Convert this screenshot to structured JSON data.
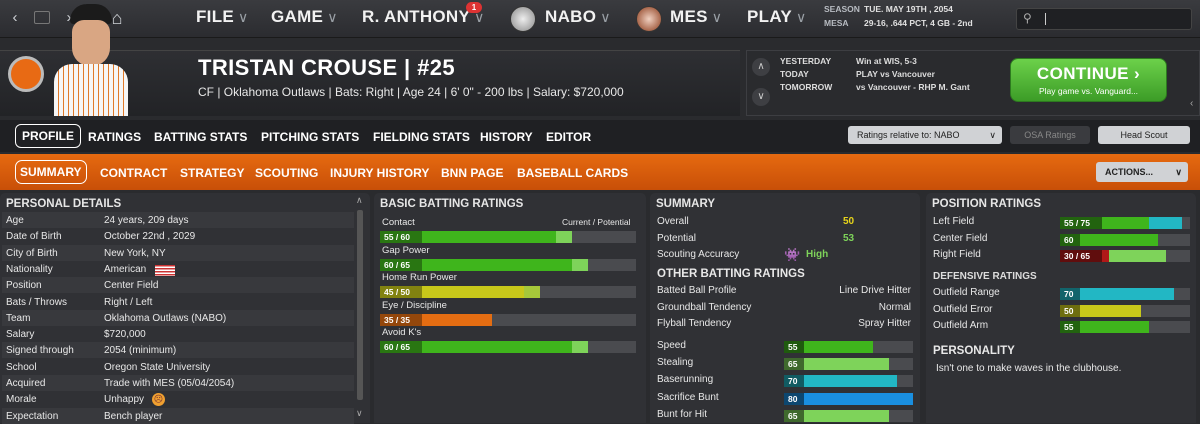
{
  "topbar": {
    "menus": [
      {
        "label": "FILE"
      },
      {
        "label": "GAME"
      },
      {
        "label": "R. ANTHONY",
        "badge": "1"
      },
      {
        "label": "NABO"
      },
      {
        "label": "MES"
      },
      {
        "label": "PLAY"
      }
    ],
    "season_label": "SEASON",
    "season_value": "TUE. MAY 19TH , 2054",
    "team_label": "MESA",
    "team_value": "29-16, .644 PCT, 4 GB - 2nd"
  },
  "player": {
    "name": "TRISTAN CROUSE",
    "separator": "|",
    "number": "#25",
    "info": "CF | Oklahoma Outlaws  |  Bats: Right  |  Age 24  |  6' 0\" - 200 lbs  |  Salary: $720,000"
  },
  "schedule": {
    "rows": [
      {
        "label": "YESTERDAY",
        "value": "Win at WIS, 5-3"
      },
      {
        "label": "TODAY",
        "value": "PLAY vs Vancouver"
      },
      {
        "label": "TOMORROW",
        "value": "vs Vancouver - RHP M. Gant"
      }
    ],
    "continue_label": "CONTINUE",
    "continue_sub": "Play game vs. Vanguard..."
  },
  "tabs1": [
    "PROFILE",
    "RATINGS",
    "BATTING STATS",
    "PITCHING STATS",
    "FIELDING STATS",
    "HISTORY",
    "EDITOR"
  ],
  "ratings_relative": "Ratings relative to: NABO",
  "osa_ratings": "OSA Ratings",
  "head_scout": "Head Scout",
  "tabs2": [
    "SUMMARY",
    "CONTRACT",
    "STRATEGY",
    "SCOUTING",
    "INJURY HISTORY",
    "BNN PAGE",
    "BASEBALL CARDS"
  ],
  "actions": "ACTIONS...",
  "personal": {
    "title": "PERSONAL DETAILS",
    "rows": [
      {
        "k": "Age",
        "v": "24 years, 209 days"
      },
      {
        "k": "Date of Birth",
        "v": "October 22nd , 2029"
      },
      {
        "k": "City of Birth",
        "v": "New York, NY"
      },
      {
        "k": "Nationality",
        "v": "American"
      },
      {
        "k": "Position",
        "v": "Center Field"
      },
      {
        "k": "Bats / Throws",
        "v": "Right / Left"
      },
      {
        "k": "Team",
        "v": "Oklahoma Outlaws (NABO)"
      },
      {
        "k": "Salary",
        "v": "$720,000"
      },
      {
        "k": "Signed through",
        "v": "2054 (minimum)"
      },
      {
        "k": "School",
        "v": "Oregon State University"
      },
      {
        "k": "Acquired",
        "v": "Trade with MES (05/04/2054)"
      },
      {
        "k": "Morale",
        "v": "Unhappy"
      },
      {
        "k": "Expectation",
        "v": "Bench player"
      }
    ]
  },
  "batting": {
    "title": "BASIC BATTING RATINGS",
    "subhead_left": "Contact",
    "subhead_right": "Current / Potential",
    "rows": [
      {
        "label": "Contact",
        "text": "55 / 60",
        "cur": 55,
        "pot": 60,
        "color": "#3fb51c",
        "pcolor": "#7ed35a"
      },
      {
        "label": "Gap Power",
        "text": "60 / 65",
        "cur": 60,
        "pot": 65,
        "color": "#3fb51c",
        "pcolor": "#7ed35a"
      },
      {
        "label": "Home Run Power",
        "text": "45 / 50",
        "cur": 45,
        "pot": 50,
        "color": "#c8c81a",
        "pcolor": "#a6c83a"
      },
      {
        "label": "Eye / Discipline",
        "text": "35 / 35",
        "cur": 35,
        "pot": 35,
        "color": "#e46d12",
        "pcolor": "#e46d12"
      },
      {
        "label": "Avoid K's",
        "text": "60 / 65",
        "cur": 60,
        "pot": 65,
        "color": "#3fb51c",
        "pcolor": "#7ed35a"
      }
    ]
  },
  "summary": {
    "title": "SUMMARY",
    "overall_label": "Overall",
    "overall": "50",
    "potential_label": "Potential",
    "potential": "53",
    "scouting_label": "Scouting Accuracy",
    "scouting": "High",
    "other_title": "OTHER BATTING RATINGS",
    "other": [
      {
        "k": "Batted Ball Profile",
        "v": "Line Drive Hitter"
      },
      {
        "k": "Groundball Tendency",
        "v": "Normal"
      },
      {
        "k": "Flyball Tendency",
        "v": "Spray Hitter"
      }
    ],
    "running": [
      {
        "k": "Speed",
        "v": "55",
        "val": 55,
        "color": "#3fb51c"
      },
      {
        "k": "Stealing",
        "v": "65",
        "val": 65,
        "color": "#7ed35a"
      },
      {
        "k": "Baserunning",
        "v": "70",
        "val": 70,
        "color": "#22b7c4"
      },
      {
        "k": "Sacrifice Bunt",
        "v": "80",
        "val": 80,
        "color": "#1a8fe0"
      },
      {
        "k": "Bunt for Hit",
        "v": "65",
        "val": 65,
        "color": "#7ed35a"
      }
    ]
  },
  "position": {
    "title": "POSITION RATINGS",
    "rows": [
      {
        "k": "Left Field",
        "text": "55 / 75",
        "cur": 55,
        "pot": 75,
        "color": "#3fb51c",
        "pcolor": "#22b7c4"
      },
      {
        "k": "Center Field",
        "text": "60",
        "cur": 60,
        "pot": 60,
        "color": "#3fb51c",
        "pcolor": "#3fb51c"
      },
      {
        "k": "Right Field",
        "text": "30 / 65",
        "cur": 30,
        "pot": 65,
        "color": "#b01818",
        "pcolor": "#7ed35a"
      }
    ],
    "def_title": "DEFENSIVE RATINGS",
    "def": [
      {
        "k": "Outfield Range",
        "text": "70",
        "val": 70,
        "color": "#22b7c4"
      },
      {
        "k": "Outfield Error",
        "text": "50",
        "val": 50,
        "color": "#c8c81a"
      },
      {
        "k": "Outfield Arm",
        "text": "55",
        "val": 55,
        "color": "#3fb51c"
      }
    ],
    "personality_title": "PERSONALITY",
    "personality": "Isn't one to make waves in the clubhouse."
  }
}
